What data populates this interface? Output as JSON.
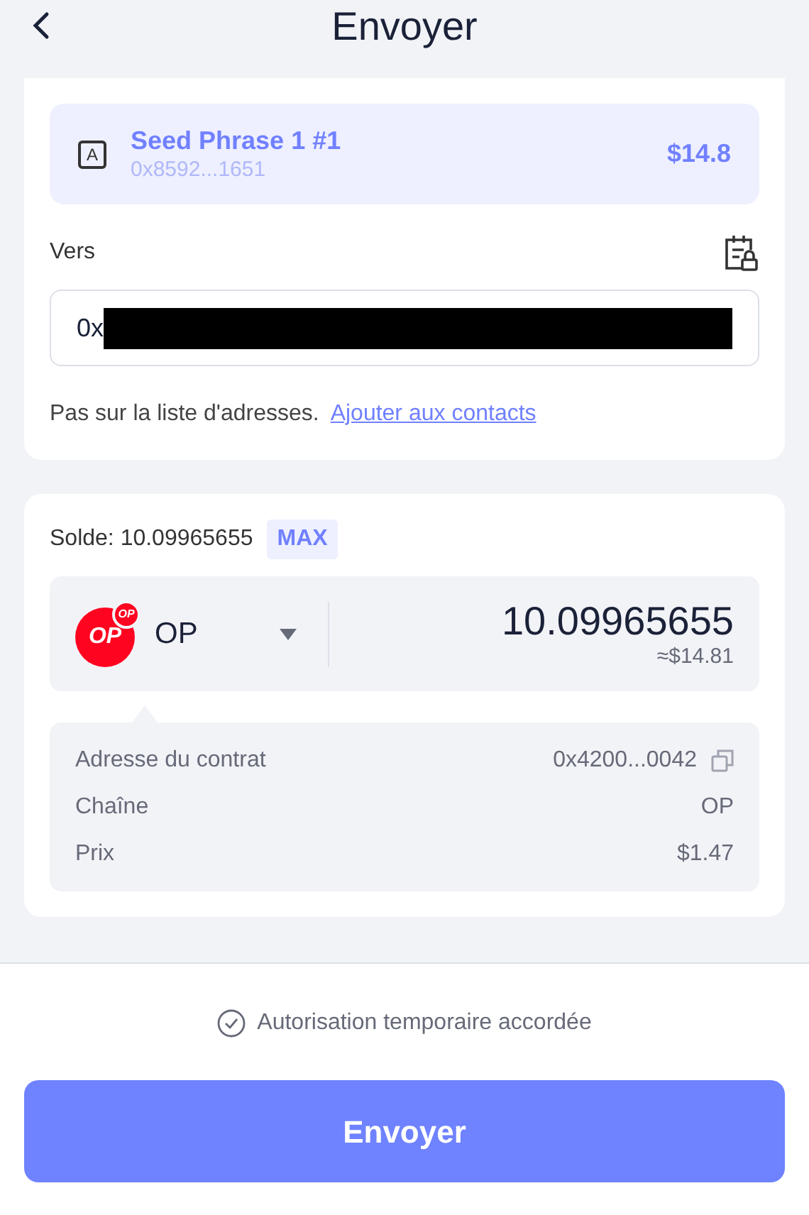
{
  "header": {
    "title": "Envoyer"
  },
  "from": {
    "account_letter": "A",
    "name": "Seed Phrase 1 #1",
    "address": "0x8592...1651",
    "value": "$14.8"
  },
  "to": {
    "label": "Vers",
    "value": "0x",
    "redacted": true,
    "note": "Pas sur la liste d'adresses.",
    "link": "Ajouter aux contacts"
  },
  "balance": {
    "label": "Solde: 10.09965655",
    "max": "MAX"
  },
  "token": {
    "logo_text": "OP",
    "badge_text": "OP",
    "symbol": "OP",
    "amount": "10.09965655",
    "fiat": "≈$14.81"
  },
  "details": [
    {
      "label": "Adresse du contrat",
      "value": "0x4200...0042",
      "copyable": true
    },
    {
      "label": "Chaîne",
      "value": "OP",
      "copyable": false
    },
    {
      "label": "Prix",
      "value": "$1.47",
      "copyable": false
    }
  ],
  "footer": {
    "authorization": "Autorisation temporaire accordée",
    "button": "Envoyer"
  }
}
